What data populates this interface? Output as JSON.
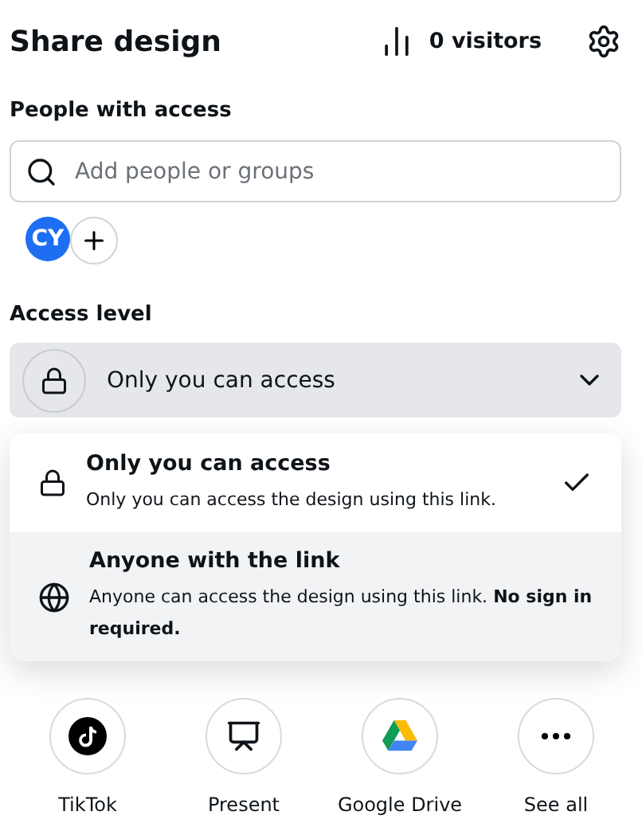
{
  "header": {
    "title": "Share design",
    "visitors": "0 visitors"
  },
  "people": {
    "label": "People with access",
    "search": {
      "placeholder": "Add people or groups"
    },
    "avatars": [
      {
        "initials": "CY"
      }
    ]
  },
  "access": {
    "label": "Access level",
    "value": "Only you can access",
    "options": [
      {
        "kind": "lock",
        "title": "Only you can access",
        "description": "Only you can access the design using this link.",
        "selected": true,
        "highlighted": false
      },
      {
        "kind": "globe",
        "title": "Anyone with the link",
        "description": "Anyone can access the design using this link. **No sign in required.**",
        "selected": false,
        "highlighted": true
      }
    ]
  },
  "share_targets": [
    {
      "kind": "tiktok",
      "label": "TikTok"
    },
    {
      "kind": "present",
      "label": "Present"
    },
    {
      "kind": "drive",
      "label": "Google Drive"
    },
    {
      "kind": "more",
      "label": "See all"
    }
  ]
}
